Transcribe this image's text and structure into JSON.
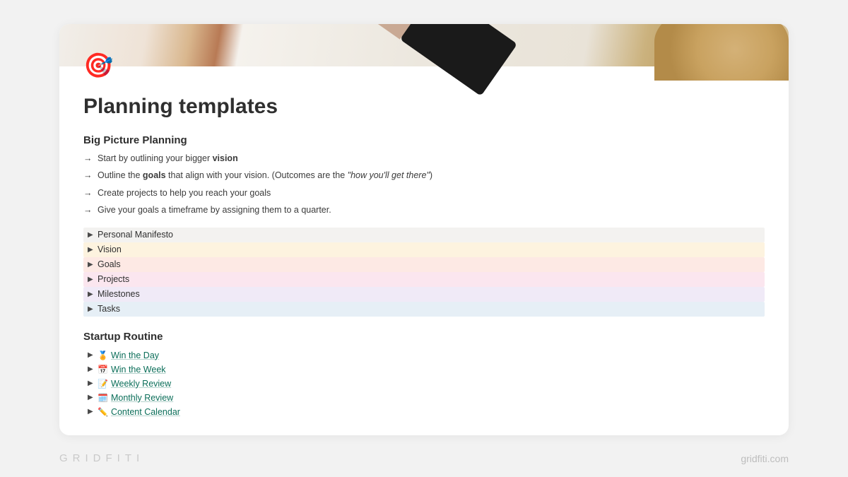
{
  "page": {
    "icon": "🎯",
    "title": "Planning templates"
  },
  "bigPicture": {
    "heading": "Big Picture Planning",
    "lines": {
      "l1_pre": "Start by outlining your bigger ",
      "l1_bold": "vision",
      "l2_pre": "Outline the ",
      "l2_bold": "goals",
      "l2_mid": " that align with your vision. (Outcomes are the ",
      "l2_italic": "\"how you'll get there\"",
      "l2_post": ")",
      "l3": "Create projects to help you reach your goals",
      "l4": "Give your goals a timeframe by assigning them to a quarter."
    }
  },
  "toggles": [
    {
      "label": "Personal Manifesto",
      "bg": "grey"
    },
    {
      "label": "Vision",
      "bg": "cream"
    },
    {
      "label": "Goals",
      "bg": "peach"
    },
    {
      "label": "Projects",
      "bg": "pink"
    },
    {
      "label": "Milestones",
      "bg": "lav"
    },
    {
      "label": "Tasks",
      "bg": "blue"
    }
  ],
  "startup": {
    "heading": "Startup Routine",
    "items": [
      {
        "emoji": "🏅",
        "label": "Win the Day"
      },
      {
        "emoji": "📅",
        "label": "Win the Week"
      },
      {
        "emoji": "📝",
        "label": "Weekly Review"
      },
      {
        "emoji": "🗓️",
        "label": "Monthly Review"
      },
      {
        "emoji": "✏️",
        "label": "Content Calendar"
      }
    ]
  },
  "footer": {
    "brand": "GRIDFITI",
    "url": "gridfiti.com"
  }
}
